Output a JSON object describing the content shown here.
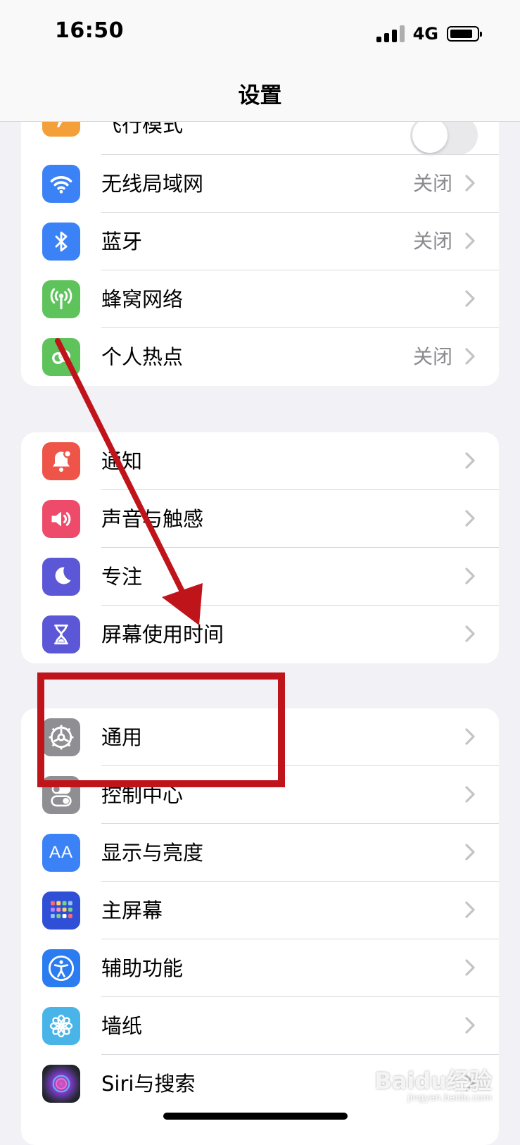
{
  "status_bar": {
    "time": "16:50",
    "network": "4G"
  },
  "nav": {
    "title": "设置"
  },
  "group1": {
    "airplane_label": "飞行模式",
    "airplane_on": false,
    "wifi_label": "无线局域网",
    "wifi_value": "关闭",
    "bluetooth_label": "蓝牙",
    "bluetooth_value": "关闭",
    "cellular_label": "蜂窝网络",
    "hotspot_label": "个人热点",
    "hotspot_value": "关闭"
  },
  "group2": {
    "notifications_label": "通知",
    "sounds_label": "声音与触感",
    "focus_label": "专注",
    "screen_time_label": "屏幕使用时间"
  },
  "group3": {
    "general_label": "通用",
    "control_center_label": "控制中心",
    "display_label": "显示与亮度",
    "home_screen_label": "主屏幕",
    "accessibility_label": "辅助功能",
    "wallpaper_label": "墙纸",
    "siri_label": "Siri与搜索"
  },
  "display_icon_text": "AA",
  "watermark": {
    "text": "Baidu经验",
    "sub": "jingyan.baidu.com"
  },
  "colors": {
    "airplane": "#f4a03a",
    "wifi": "#3b82f6",
    "bluetooth": "#3b82f6",
    "cellular": "#5fc35c",
    "hotspot": "#5fc35c",
    "notifications": "#ee5447",
    "sounds": "#ee4a6a",
    "focus": "#5c57d6",
    "screen_time": "#5c57d6",
    "general": "#8e8e93",
    "control_center": "#8e8e93",
    "display": "#3b82f6",
    "home_screen": "#2f4fd6",
    "accessibility": "#2b7cf0",
    "wallpaper": "#48b4e8",
    "annotation": "#c0141b"
  },
  "icons": {
    "airplane": "airplane-icon",
    "wifi": "wifi-icon",
    "bluetooth": "bluetooth-icon",
    "cellular": "cellular-antenna-icon",
    "hotspot": "hotspot-icon",
    "notifications": "bell-icon",
    "sounds": "speaker-icon",
    "focus": "moon-icon",
    "screen_time": "hourglass-icon",
    "general": "gear-icon",
    "control_center": "toggles-icon",
    "display": "text-size-icon",
    "home_screen": "app-grid-icon",
    "accessibility": "accessibility-person-icon",
    "wallpaper": "flower-icon",
    "siri": "siri-orb-icon"
  }
}
